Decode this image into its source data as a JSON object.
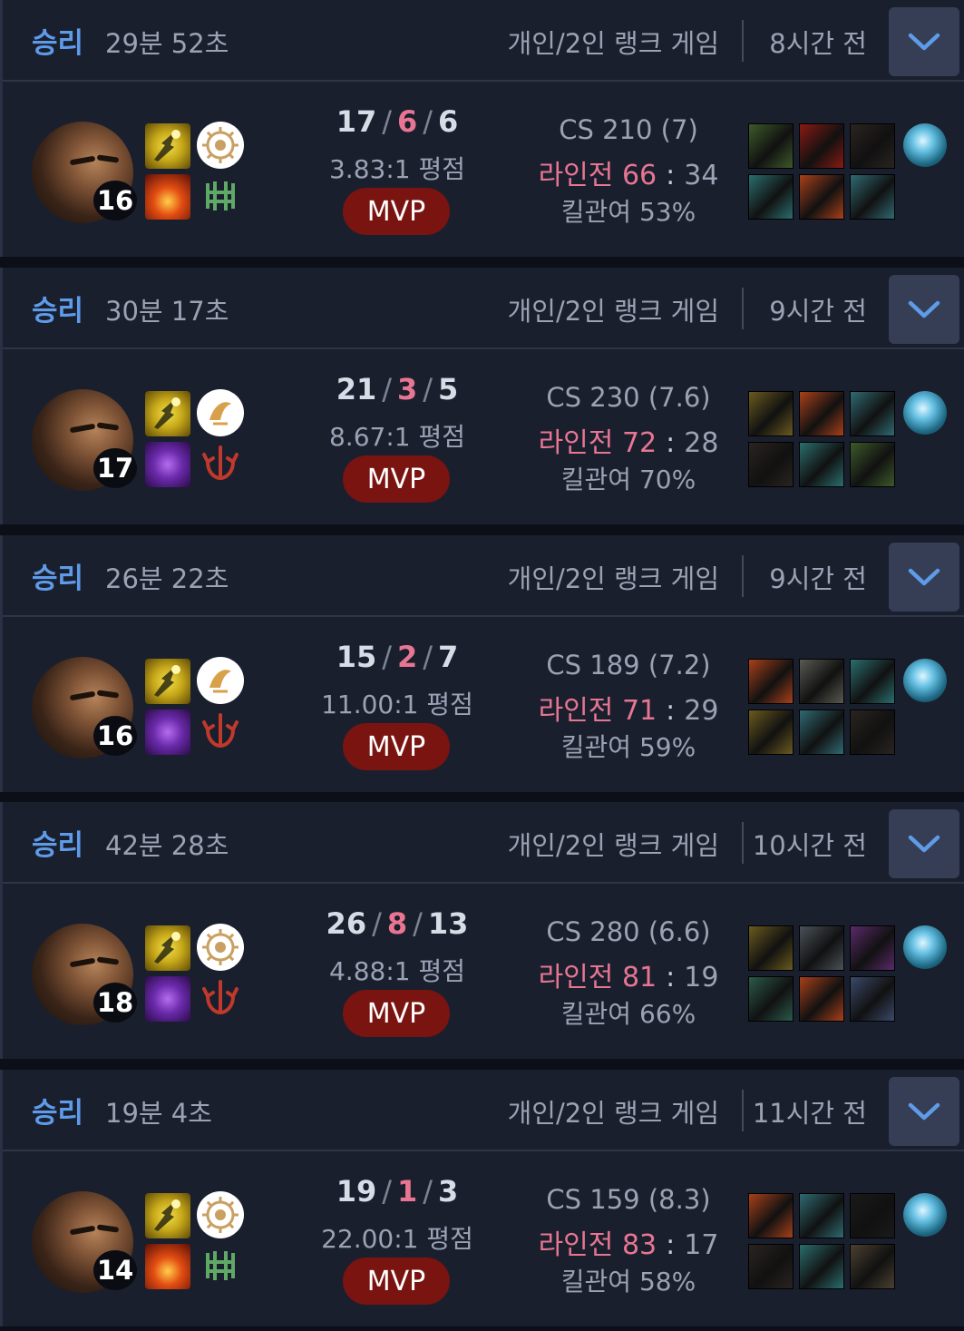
{
  "colors": {
    "win": "#5e9be8",
    "deaths": "#e87692",
    "mvp_bg": "#7a1410",
    "panel_bg": "#1a1f2e",
    "expand_btn_bg": "#363e55"
  },
  "matches": [
    {
      "result": "승리",
      "duration": "29분 52초",
      "queue": "개인/2인 랭크 게임",
      "time_ago": "8시간 전",
      "level": "16",
      "spells": [
        "flash",
        "ignite"
      ],
      "runes": [
        "conqueror",
        "resolve"
      ],
      "kills": "17",
      "deaths": "6",
      "assists": "6",
      "ratio": "3.83:1 평점",
      "badge": "MVP",
      "cs": "CS 210 (7)",
      "lane_label": "라인전",
      "lane_win": "66",
      "lane_loss": "34",
      "kill_participation": "킬관여 53%",
      "items": [
        "#3d5a2a",
        "#8a1a12",
        "#2a2420",
        "#2b6e6e",
        "#a8401a",
        "#2f6a72"
      ]
    },
    {
      "result": "승리",
      "duration": "30분 17초",
      "queue": "개인/2인 랭크 게임",
      "time_ago": "9시간 전",
      "level": "17",
      "spells": [
        "flash",
        "exhaust"
      ],
      "runes": [
        "lethal-tempo",
        "domination"
      ],
      "kills": "21",
      "deaths": "3",
      "assists": "5",
      "ratio": "8.67:1 평점",
      "badge": "MVP",
      "cs": "CS 230 (7.6)",
      "lane_label": "라인전",
      "lane_win": "72",
      "lane_loss": "28",
      "kill_participation": "킬관여 70%",
      "items": [
        "#6a5a1e",
        "#a8401a",
        "#2f6a72",
        "#2a2420",
        "#2b6e6e",
        "#3d5a2a"
      ]
    },
    {
      "result": "승리",
      "duration": "26분 22초",
      "queue": "개인/2인 랭크 게임",
      "time_ago": "9시간 전",
      "level": "16",
      "spells": [
        "flash",
        "exhaust"
      ],
      "runes": [
        "lethal-tempo",
        "domination"
      ],
      "kills": "15",
      "deaths": "2",
      "assists": "7",
      "ratio": "11.00:1 평점",
      "badge": "MVP",
      "cs": "CS 189 (7.2)",
      "lane_label": "라인전",
      "lane_win": "71",
      "lane_loss": "29",
      "kill_participation": "킬관여 59%",
      "items": [
        "#a8401a",
        "#5a5a52",
        "#2b6e6e",
        "#6a5a1e",
        "#2f6a72",
        "#2a2420"
      ]
    },
    {
      "result": "승리",
      "duration": "42분 28초",
      "queue": "개인/2인 랭크 게임",
      "time_ago": "10시간 전",
      "level": "18",
      "spells": [
        "flash",
        "exhaust"
      ],
      "runes": [
        "conqueror",
        "domination"
      ],
      "kills": "26",
      "deaths": "8",
      "assists": "13",
      "ratio": "4.88:1 평점",
      "badge": "MVP",
      "cs": "CS 280 (6.6)",
      "lane_label": "라인전",
      "lane_win": "81",
      "lane_loss": "19",
      "kill_participation": "킬관여 66%",
      "items": [
        "#6a5a1e",
        "#4a5258",
        "#5a2a6a",
        "#2a5a4a",
        "#a8401a",
        "#3a4a6a"
      ]
    },
    {
      "result": "승리",
      "duration": "19분 4초",
      "queue": "개인/2인 랭크 게임",
      "time_ago": "11시간 전",
      "level": "14",
      "spells": [
        "flash",
        "ignite"
      ],
      "runes": [
        "conqueror",
        "resolve"
      ],
      "kills": "19",
      "deaths": "1",
      "assists": "3",
      "ratio": "22.00:1 평점",
      "badge": "MVP",
      "cs": "CS 159 (8.3)",
      "lane_label": "라인전",
      "lane_win": "83",
      "lane_loss": "17",
      "kill_participation": "킬관여 58%",
      "items": [
        "#a8401a",
        "#2f6a72",
        "#1a1a1a",
        "#2a2420",
        "#2b6e6e",
        "#4a4030"
      ]
    }
  ]
}
